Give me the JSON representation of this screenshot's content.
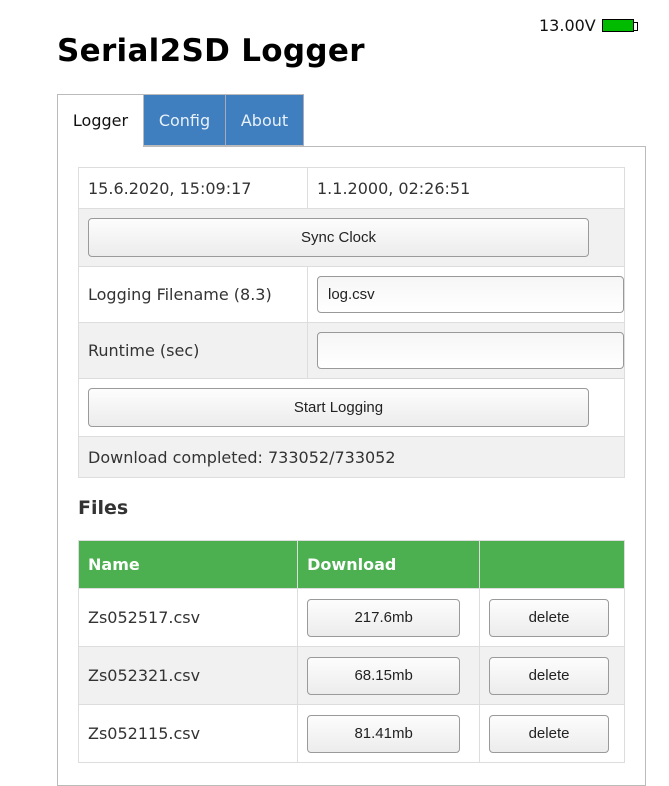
{
  "status": {
    "voltage": "13.00V",
    "battery_icon": "battery-full-icon",
    "battery_color": "#00bb00"
  },
  "header": {
    "title": "Serial2SD Logger"
  },
  "tabs": [
    {
      "label": "Logger",
      "active": true
    },
    {
      "label": "Config",
      "active": false
    },
    {
      "label": "About",
      "active": false
    }
  ],
  "logger": {
    "browser_time": "15.6.2020, 15:09:17",
    "device_time": "1.1.2000, 02:26:51",
    "sync_clock_label": "Sync Clock",
    "filename_label": "Logging Filename (8.3)",
    "filename_value": "log.csv",
    "runtime_label": "Runtime (sec)",
    "runtime_value": "",
    "start_logging_label": "Start Logging",
    "download_status": "Download completed: 733052/733052"
  },
  "files": {
    "heading": "Files",
    "columns": [
      "Name",
      "Download",
      ""
    ],
    "rows": [
      {
        "name": "Zs052517.csv",
        "size": "217.6mb",
        "delete_label": "delete"
      },
      {
        "name": "Zs052321.csv",
        "size": "68.15mb",
        "delete_label": "delete"
      },
      {
        "name": "Zs052115.csv",
        "size": "81.41mb",
        "delete_label": "delete"
      }
    ]
  },
  "colors": {
    "tab_inactive": "#3f7fbf",
    "table_header": "#4caf50"
  }
}
